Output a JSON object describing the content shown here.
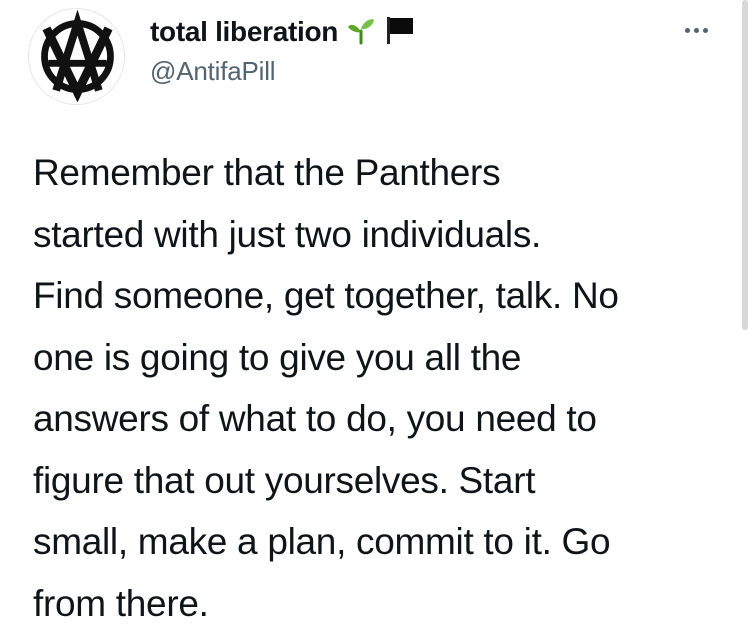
{
  "user": {
    "display_name": "total liberation",
    "handle": "@AntifaPill",
    "name_emojis": [
      "seedling-icon",
      "black-flag-icon"
    ]
  },
  "menu": {
    "more_icon": "more-horizontal-icon"
  },
  "tweet": {
    "lines": [
      "Remember that the Panthers",
      "started with just two individuals.",
      "Find someone, get together, talk. No",
      "one is going to give you all the",
      "answers of what to do, you need to",
      "figure that out yourselves. Start",
      "small, make a plan, commit to it. Go",
      "from there."
    ]
  },
  "colors": {
    "text_primary": "#0f1419",
    "text_secondary": "#536471",
    "seedling_green": "#5ba829"
  }
}
